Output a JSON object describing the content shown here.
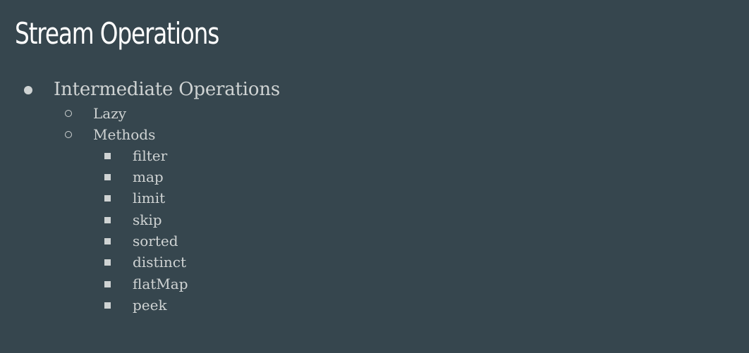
{
  "slide": {
    "title": "Stream Operations",
    "bullets": {
      "level1": "Intermediate Operations",
      "level2": [
        "Lazy",
        "Methods"
      ],
      "methods": [
        "filter",
        "map",
        "limit",
        "skip",
        "sorted",
        "distinct",
        "flatMap",
        "peek"
      ]
    },
    "colors": {
      "background": "#36464e",
      "title": "#ffffff",
      "text": "#cfd3d3"
    },
    "bullet_icons": {
      "level1": "filled-circle-icon",
      "level2": "hollow-circle-icon",
      "level3": "filled-square-icon"
    }
  }
}
